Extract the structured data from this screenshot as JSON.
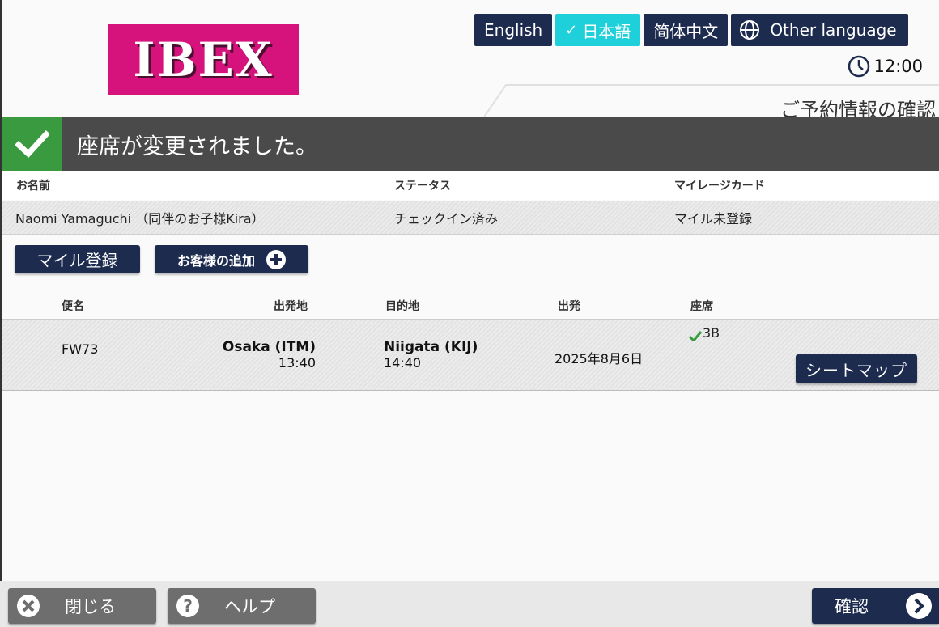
{
  "logo": {
    "text": "IBEX",
    "color": "#d6127c"
  },
  "languages": [
    {
      "label": "English",
      "active": false
    },
    {
      "label": "日本語",
      "active": true
    },
    {
      "label": "简体中文",
      "active": false
    },
    {
      "label": "Other language",
      "active": false,
      "icon": "globe-icon"
    }
  ],
  "clock": {
    "time": "12:00",
    "icon": "clock-icon"
  },
  "page_title": "ご予約情報の確認",
  "banner": {
    "message": "座席が変更されました。",
    "icon": "check-icon",
    "color": "#3a9a3f"
  },
  "passenger": {
    "headers": {
      "name": "お名前",
      "status": "ステータス",
      "mileage": "マイレージカード"
    },
    "name": "Naomi Yamaguchi （同伴のお子様Kira）",
    "status": "チェックイン済み",
    "mileage": "マイル未登録"
  },
  "actions": {
    "miles_label": "マイル登録",
    "add_label": "お客様の追加"
  },
  "flight_table": {
    "headers": {
      "flight": "便名",
      "origin": "出発地",
      "destination": "目的地",
      "departure": "出発",
      "seat": "座席"
    },
    "row": {
      "flight": "FW73",
      "origin": "Osaka (ITM)",
      "origin_time": "13:40",
      "destination": "Niigata (KIJ)",
      "destination_time": "14:40",
      "date": "2025年8月6日",
      "seat": "3B",
      "seat_map_label": "シートマップ"
    }
  },
  "footer": {
    "close_label": "閉じる",
    "help_label": "ヘルプ",
    "confirm_label": "確認"
  },
  "colors": {
    "navy": "#1d2b4f",
    "active_lang": "#1ed0d9",
    "banner": "#4a4a4a"
  }
}
